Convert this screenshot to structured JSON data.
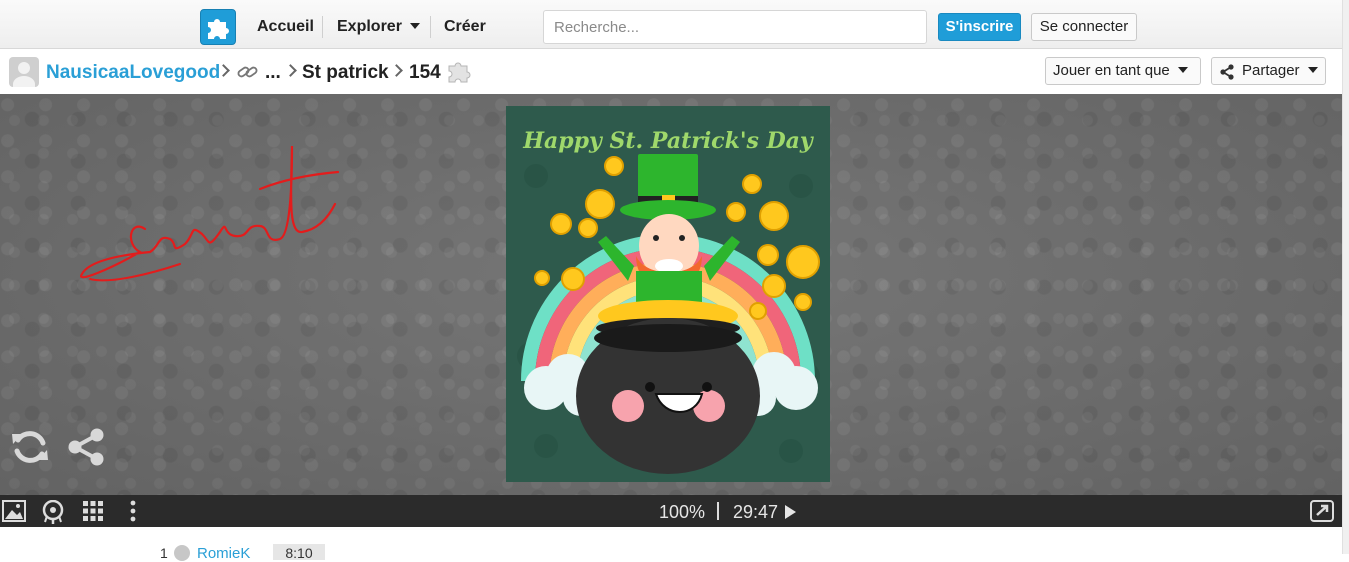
{
  "nav": {
    "home": "Accueil",
    "explore": "Explorer",
    "create": "Créer",
    "search_placeholder": "Recherche...",
    "signup": "S'inscrire",
    "login": "Se connecter"
  },
  "breadcrumb": {
    "user": "NausicaaLovegood",
    "ellipsis": "...",
    "album": "St patrick",
    "pieces": "154"
  },
  "actions": {
    "play_as": "Jouer en tant que",
    "share": "Partager"
  },
  "puzzle": {
    "image_title": "Happy St. Patrick's Day",
    "handwriting": "Jawrat"
  },
  "controls": {
    "zoom": "100%",
    "separator": "|",
    "timer": "29:47"
  },
  "leaderboard": {
    "rank": "1",
    "user": "RomieK",
    "time": "8:10"
  },
  "colors": {
    "accent": "#1f9dd8",
    "link": "#2a9fd6",
    "poster_bg": "#2e5a4c",
    "hat_green": "#2db52d"
  }
}
